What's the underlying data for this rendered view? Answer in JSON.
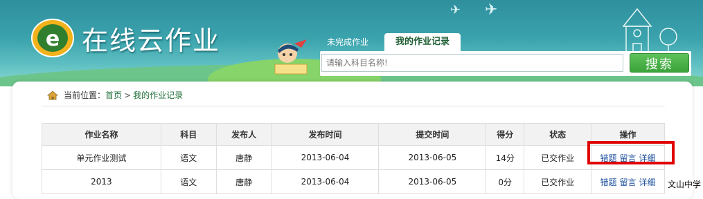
{
  "header": {
    "logo_text": "在线云作业",
    "tabs": [
      {
        "label": "未完成作业"
      },
      {
        "label": "我的作业记录"
      }
    ],
    "search": {
      "placeholder": "请输入科目名称!",
      "value": "",
      "button_label": "搜索"
    }
  },
  "breadcrumb": {
    "prefix": "当前位置：",
    "home": "首页",
    "separator": ">",
    "current": "我的作业记录"
  },
  "table": {
    "columns": [
      "作业名称",
      "科目",
      "发布人",
      "发布时间",
      "提交时间",
      "得分",
      "状态",
      "操作"
    ],
    "rows": [
      {
        "name": "单元作业测试",
        "subject": "语文",
        "publisher": "唐静",
        "published": "2013-06-04",
        "submitted": "2013-06-05",
        "score": "14分",
        "status": "已交作业",
        "actions": [
          "错题",
          "留言",
          "详细"
        ]
      },
      {
        "name": "2013",
        "subject": "语文",
        "publisher": "唐静",
        "published": "2013-06-04",
        "submitted": "2013-06-05",
        "score": "0分",
        "status": "已交作业",
        "actions": [
          "错题",
          "留言",
          "详细"
        ]
      }
    ]
  },
  "watermark": "文山中学",
  "colors": {
    "header_teal": "#3ba3ad",
    "button_green": "#3aa33a",
    "link_blue": "#1b4f9c",
    "highlight_red": "#e00000"
  }
}
